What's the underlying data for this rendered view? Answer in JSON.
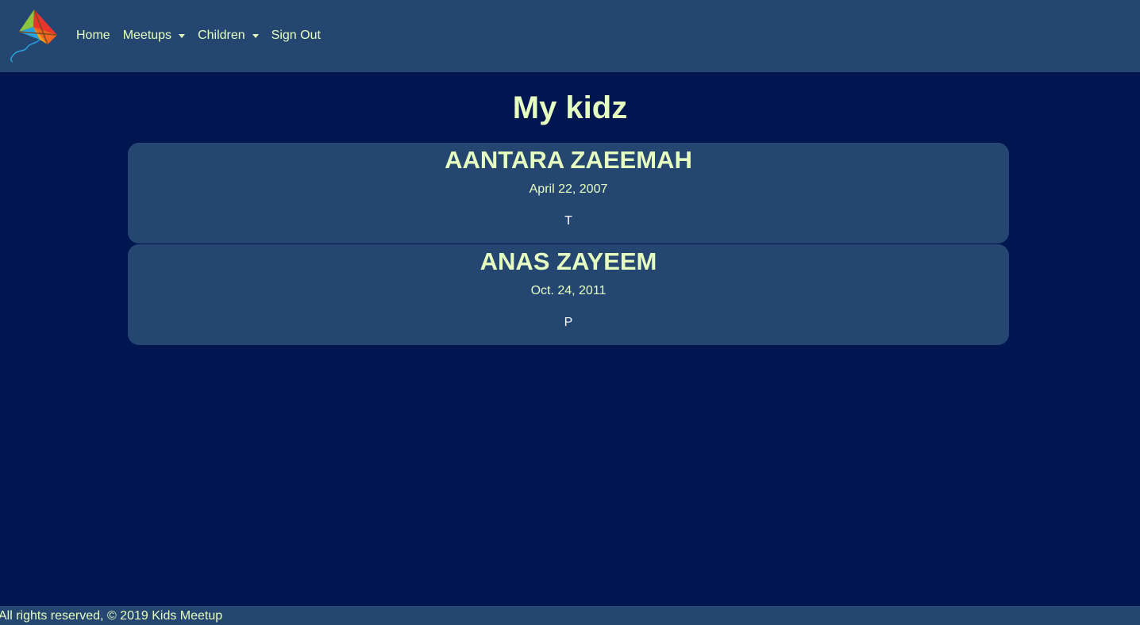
{
  "nav": {
    "items": [
      {
        "label": "Home",
        "dropdown": false
      },
      {
        "label": "Meetups",
        "dropdown": true
      },
      {
        "label": "Children",
        "dropdown": true
      },
      {
        "label": "Sign Out",
        "dropdown": false
      }
    ]
  },
  "main": {
    "title": "My kidz",
    "children": [
      {
        "name": "AANTARA ZAEEMAH",
        "date": "April 22, 2007",
        "letter": "T"
      },
      {
        "name": "ANAS ZAYEEM",
        "date": "Oct. 24, 2011",
        "letter": "P"
      }
    ]
  },
  "footer": {
    "text": "All rights reserved, © 2019 Kids Meetup"
  },
  "colors": {
    "background": "#001650",
    "bars_and_cards": "#244670",
    "accent_text": "#e6ffc0"
  },
  "icons": {
    "logo": "kite-icon",
    "dropdown": "caret-down-icon"
  }
}
